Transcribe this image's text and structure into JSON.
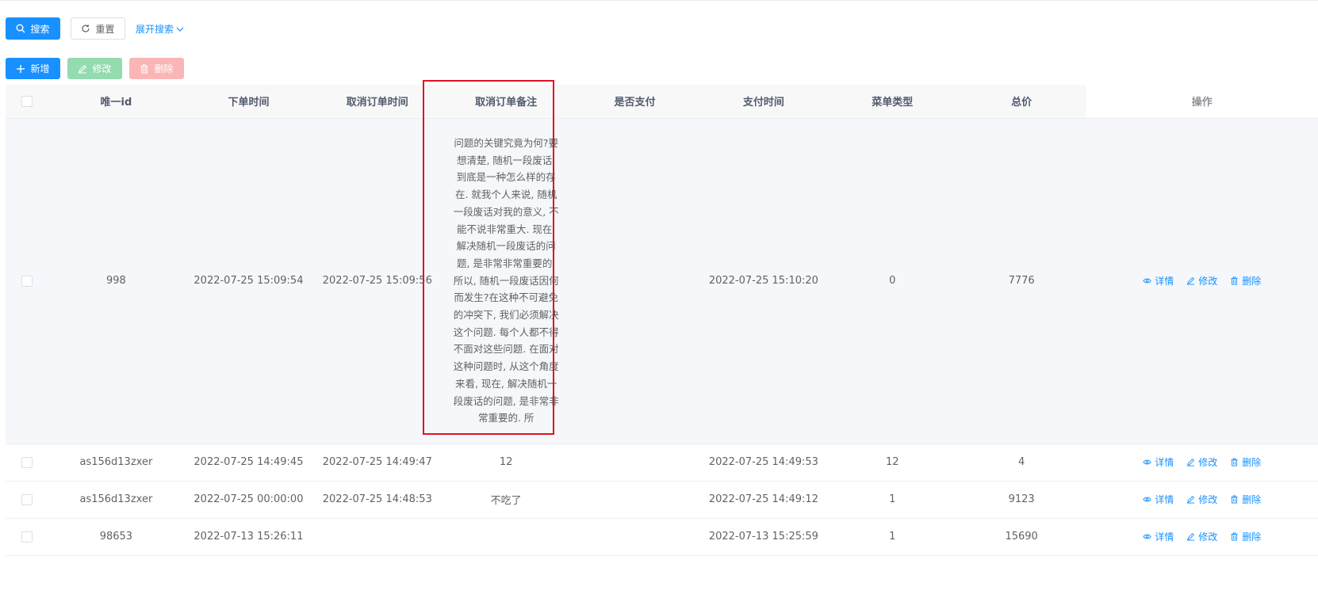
{
  "search_bar": {
    "search_label": "搜索",
    "reset_label": "重置",
    "expand_label": "展开搜索"
  },
  "toolbar": {
    "add_label": "新增",
    "edit_label": "修改",
    "delete_label": "删除"
  },
  "table": {
    "columns": [
      "唯一id",
      "下单时间",
      "取消订单时间",
      "取消订单备注",
      "是否支付",
      "支付时间",
      "菜单类型",
      "总价",
      "操作"
    ],
    "action_labels": {
      "detail": "详情",
      "edit": "修改",
      "delete": "删除"
    },
    "rows": [
      {
        "id": "998",
        "order_time": "2022-07-25 15:09:54",
        "cancel_time": "2022-07-25 15:09:56",
        "cancel_remark": "问题的关键究竟为何?要想清楚, 随机一段废话, 到底是一种怎么样的存在. 就我个人来说, 随机一段废话对我的意义, 不能不说非常重大. 现在, 解决随机一段废话的问题, 是非常非常重要的. 所以, 随机一段废话因何而发生?在这种不可避免的冲突下, 我们必须解决这个问题. 每个人都不得不面对这些问题. 在面对这种问题时, 从这个角度来看, 现在, 解决随机一段废话的问题, 是非常非常重要的. 所",
        "paid": "",
        "pay_time": "2022-07-25 15:10:20",
        "menu_type": "0",
        "total": "7776"
      },
      {
        "id": "as156d13zxer",
        "order_time": "2022-07-25 14:49:45",
        "cancel_time": "2022-07-25 14:49:47",
        "cancel_remark": "12",
        "paid": "",
        "pay_time": "2022-07-25 14:49:53",
        "menu_type": "12",
        "total": "4"
      },
      {
        "id": "as156d13zxer",
        "order_time": "2022-07-25 00:00:00",
        "cancel_time": "2022-07-25 14:48:53",
        "cancel_remark": "不吃了",
        "paid": "",
        "pay_time": "2022-07-25 14:49:12",
        "menu_type": "1",
        "total": "9123"
      },
      {
        "id": "98653",
        "order_time": "2022-07-13 15:26:11",
        "cancel_time": "",
        "cancel_remark": "",
        "paid": "",
        "pay_time": "2022-07-13 15:25:59",
        "menu_type": "1",
        "total": "15690"
      }
    ]
  },
  "colors": {
    "primary": "#1890ff",
    "success_disabled": "#95dbb0",
    "danger_disabled": "#fab6b6",
    "highlight_box": "#e0141e"
  }
}
